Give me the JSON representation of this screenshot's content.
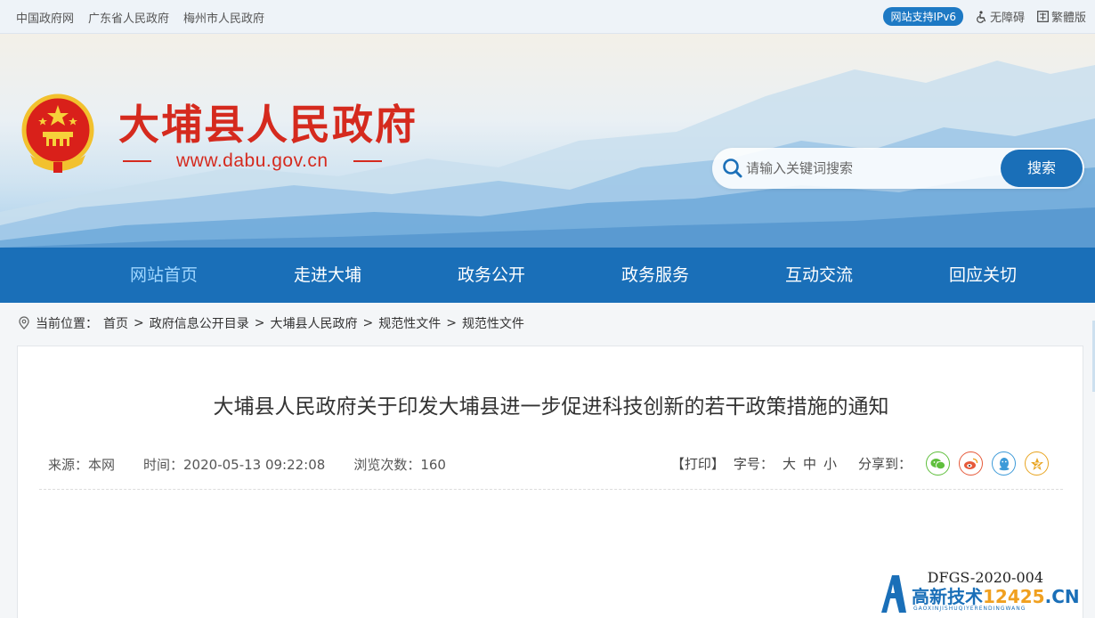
{
  "topbar": {
    "links": [
      "中国政府网",
      "广东省人民政府",
      "梅州市人民政府"
    ],
    "ipv6": "网站支持IPv6",
    "accessibility": "无障碍",
    "traditional": "繁體版"
  },
  "header": {
    "site_title": "大埔县人民政府",
    "site_url": "www.dabu.gov.cn"
  },
  "search": {
    "placeholder": "请输入关键词搜索",
    "button": "搜索"
  },
  "nav": {
    "items": [
      "网站首页",
      "走进大埔",
      "政务公开",
      "政务服务",
      "互动交流",
      "回应关切"
    ],
    "active_index": 0
  },
  "breadcrumb": {
    "label": "当前位置：",
    "items": [
      "首页",
      "政府信息公开目录",
      "大埔县人民政府",
      "规范性文件",
      "规范性文件"
    ],
    "separator": ">"
  },
  "article": {
    "title": "大埔县人民政府关于印发大埔县进一步促进科技创新的若干政策措施的通知",
    "source": "来源：本网",
    "time": "时间：2020-05-13 09:22:08",
    "views": "浏览次数：160",
    "print": "【打印】",
    "font_label": "字号：",
    "font_sizes": [
      "大",
      "中",
      "小"
    ],
    "share_label": "分享到：",
    "share_icons": [
      "wechat-icon",
      "weibo-icon",
      "qq-icon",
      "qzone-icon"
    ],
    "doc_number": "DFGS-2020-004"
  },
  "watermark": {
    "text_main": "高新技术",
    "text_num": "12425",
    "text_tail": ".CN",
    "sub": "GAOXINJISHUQIYERENDINGWANG"
  },
  "colors": {
    "brand_blue": "#1a6fb8",
    "title_red": "#d52a1e"
  }
}
